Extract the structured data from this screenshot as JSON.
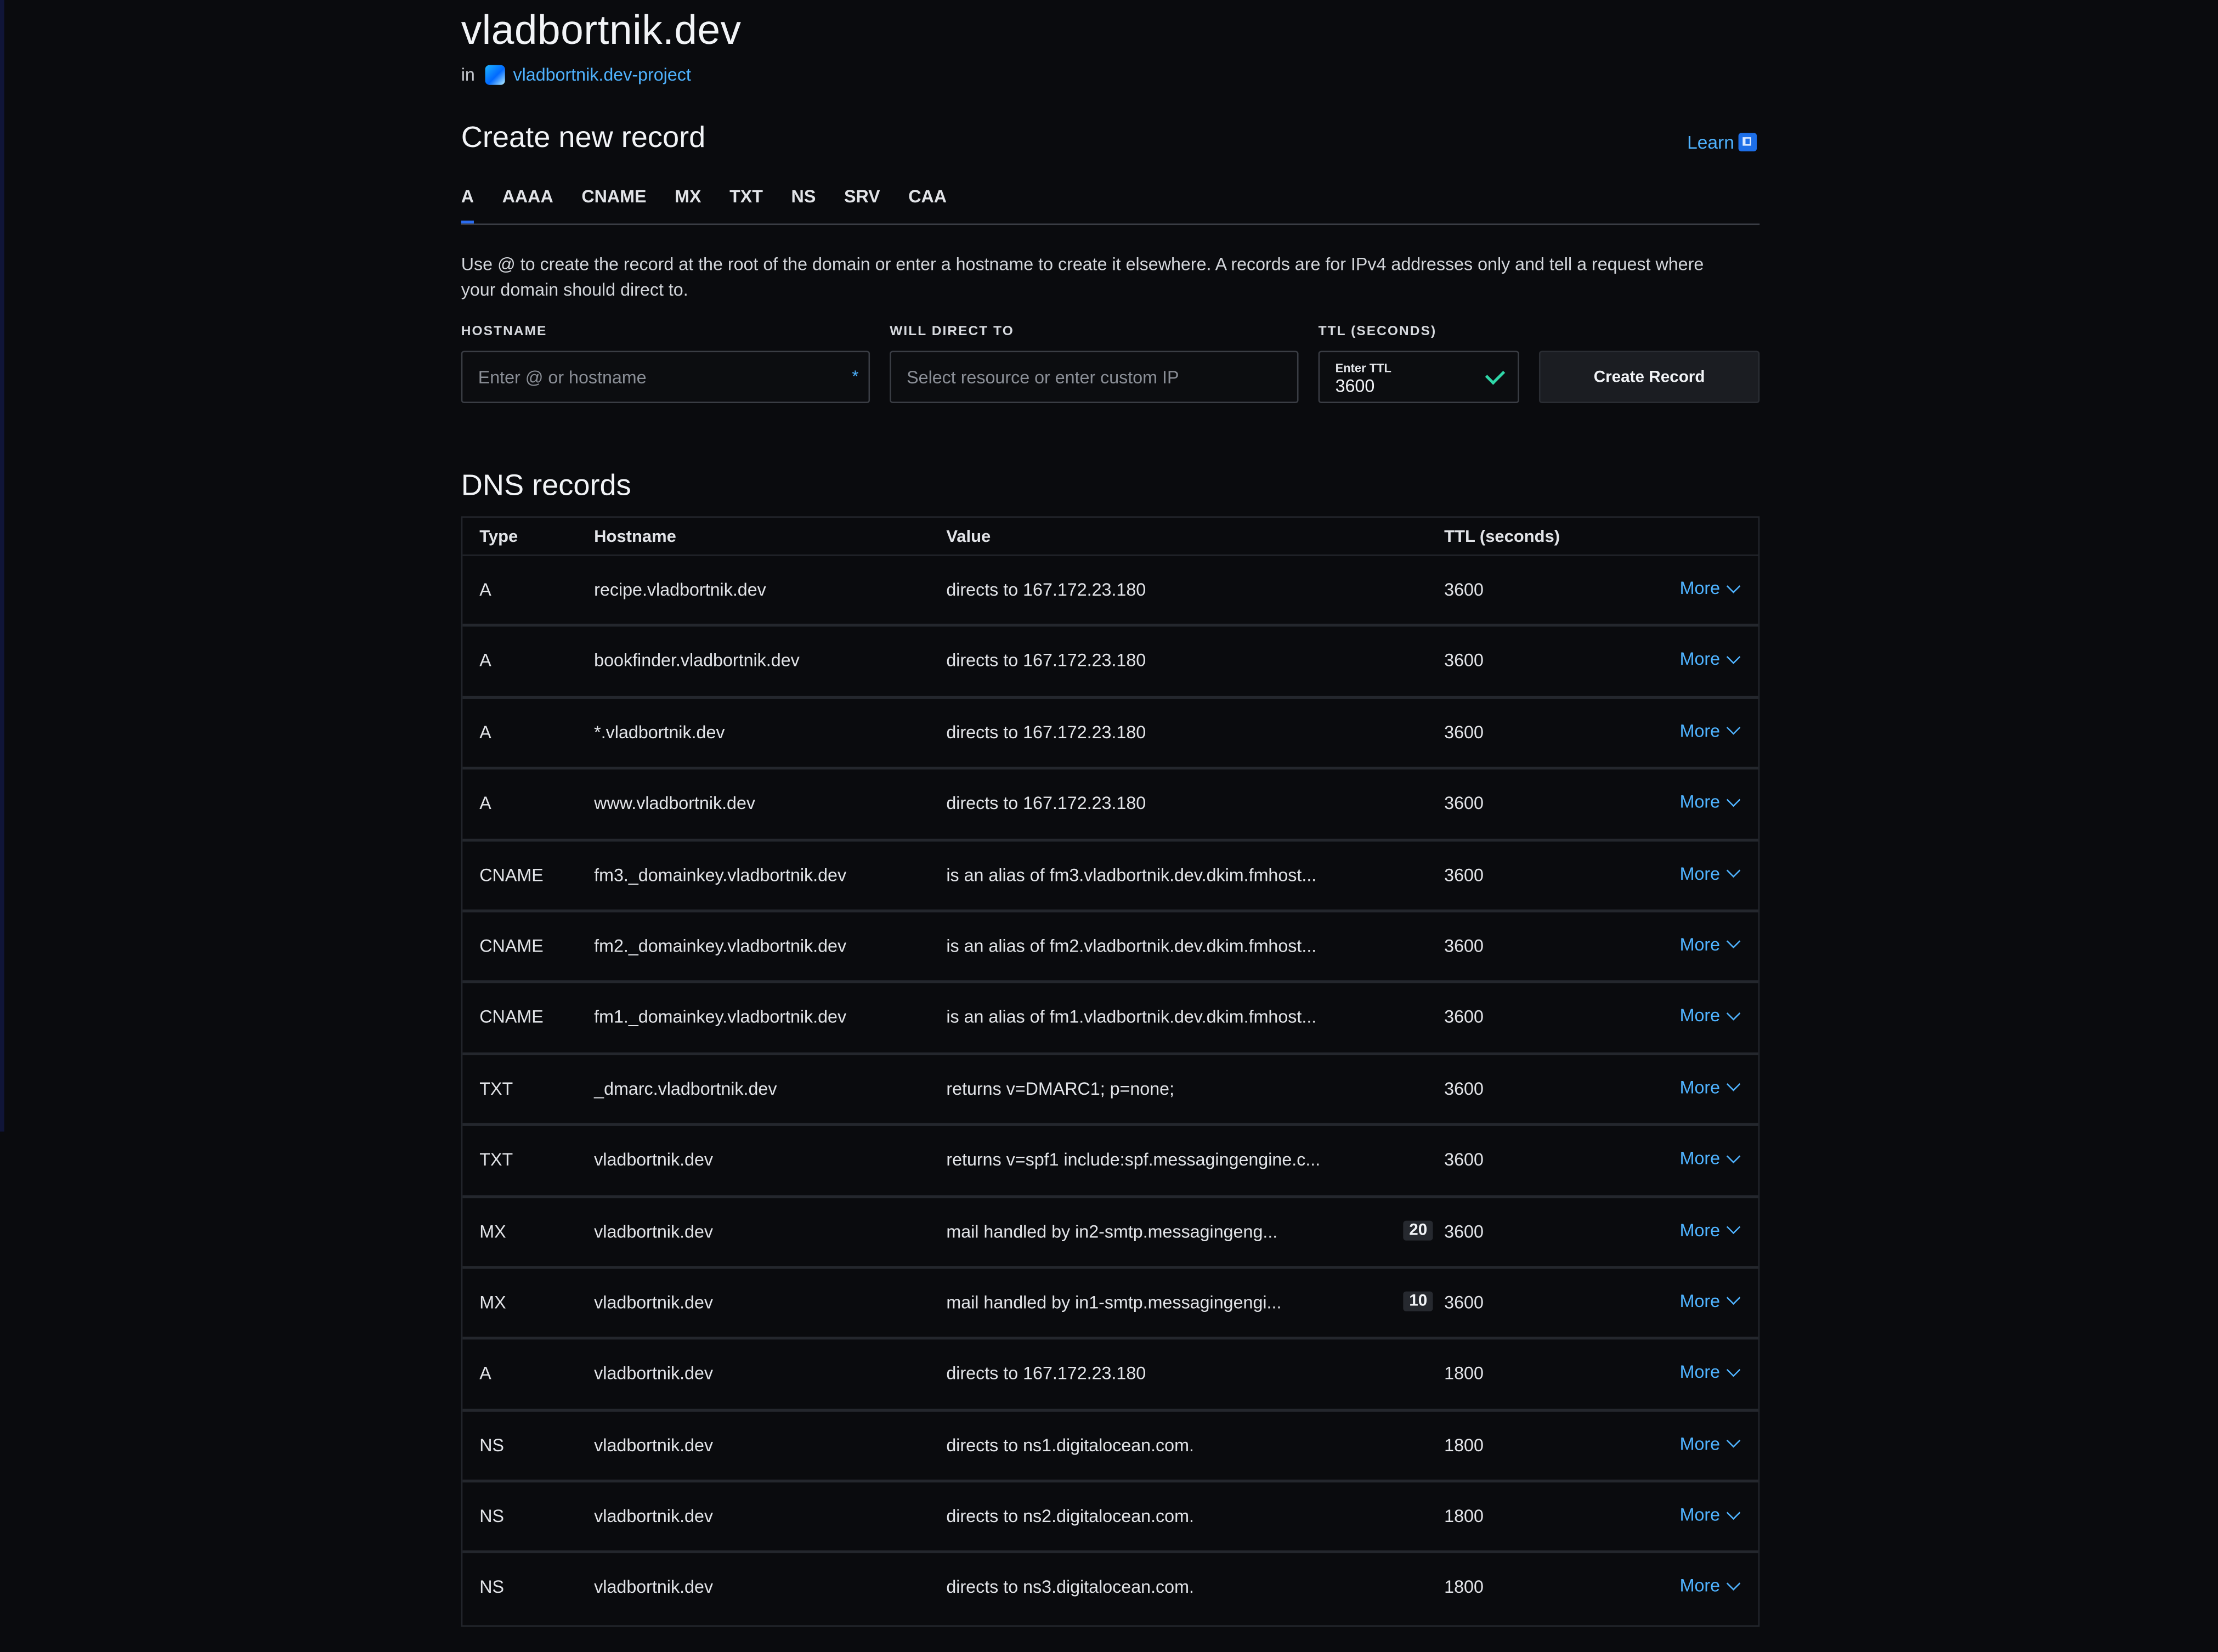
{
  "domain": {
    "title": "vladbortnik.dev",
    "in_label": "in",
    "project_name": "vladbortnik.dev-project"
  },
  "create": {
    "title": "Create new record",
    "learn_label": "Learn",
    "tabs": [
      "A",
      "AAAA",
      "CNAME",
      "MX",
      "TXT",
      "NS",
      "SRV",
      "CAA"
    ],
    "active_tab": "A",
    "help_text": "Use @ to create the record at the root of the domain or enter a hostname to create it elsewhere. A records are for IPv4 addresses only and tell a request where your domain should direct to.",
    "hostname_label": "HOSTNAME",
    "hostname_placeholder": "Enter @ or hostname",
    "hostname_required_mark": "*",
    "direct_label": "WILL DIRECT TO",
    "direct_placeholder": "Select resource or enter custom IP",
    "ttl_label": "TTL (SECONDS)",
    "ttl_inner_label": "Enter TTL",
    "ttl_value": "3600",
    "submit_label": "Create Record"
  },
  "records": {
    "title": "DNS records",
    "headers": {
      "type": "Type",
      "hostname": "Hostname",
      "value": "Value",
      "ttl": "TTL (seconds)"
    },
    "more_label": "More",
    "rows": [
      {
        "type": "A",
        "hostname": "recipe.vladbortnik.dev",
        "value": "directs to 167.172.23.180",
        "priority": "",
        "ttl": "3600"
      },
      {
        "type": "A",
        "hostname": "bookfinder.vladbortnik.dev",
        "value": "directs to 167.172.23.180",
        "priority": "",
        "ttl": "3600"
      },
      {
        "type": "A",
        "hostname": "*.vladbortnik.dev",
        "value": "directs to 167.172.23.180",
        "priority": "",
        "ttl": "3600"
      },
      {
        "type": "A",
        "hostname": "www.vladbortnik.dev",
        "value": "directs to 167.172.23.180",
        "priority": "",
        "ttl": "3600"
      },
      {
        "type": "CNAME",
        "hostname": "fm3._domainkey.vladbortnik.dev",
        "value": "is an alias of fm3.vladbortnik.dev.dkim.fmhost...",
        "priority": "",
        "ttl": "3600"
      },
      {
        "type": "CNAME",
        "hostname": "fm2._domainkey.vladbortnik.dev",
        "value": "is an alias of fm2.vladbortnik.dev.dkim.fmhost...",
        "priority": "",
        "ttl": "3600"
      },
      {
        "type": "CNAME",
        "hostname": "fm1._domainkey.vladbortnik.dev",
        "value": "is an alias of fm1.vladbortnik.dev.dkim.fmhost...",
        "priority": "",
        "ttl": "3600"
      },
      {
        "type": "TXT",
        "hostname": "_dmarc.vladbortnik.dev",
        "value": "returns v=DMARC1; p=none;",
        "priority": "",
        "ttl": "3600"
      },
      {
        "type": "TXT",
        "hostname": "vladbortnik.dev",
        "value": "returns v=spf1 include:spf.messagingengine.c...",
        "priority": "",
        "ttl": "3600"
      },
      {
        "type": "MX",
        "hostname": "vladbortnik.dev",
        "value": "mail handled by in2-smtp.messagingeng...",
        "priority": "20",
        "ttl": "3600"
      },
      {
        "type": "MX",
        "hostname": "vladbortnik.dev",
        "value": "mail handled by in1-smtp.messagingengi...",
        "priority": "10",
        "ttl": "3600"
      },
      {
        "type": "A",
        "hostname": "vladbortnik.dev",
        "value": "directs to 167.172.23.180",
        "priority": "",
        "ttl": "1800"
      },
      {
        "type": "NS",
        "hostname": "vladbortnik.dev",
        "value": "directs to ns1.digitalocean.com.",
        "priority": "",
        "ttl": "1800"
      },
      {
        "type": "NS",
        "hostname": "vladbortnik.dev",
        "value": "directs to ns2.digitalocean.com.",
        "priority": "",
        "ttl": "1800"
      },
      {
        "type": "NS",
        "hostname": "vladbortnik.dev",
        "value": "directs to ns3.digitalocean.com.",
        "priority": "",
        "ttl": "1800"
      }
    ]
  },
  "colors": {
    "background": "#0a0b0e",
    "accent_link": "#4fb3ff",
    "active_tab_underline": "#2a6cf0",
    "ttl_valid_check": "#2fd7a8"
  }
}
